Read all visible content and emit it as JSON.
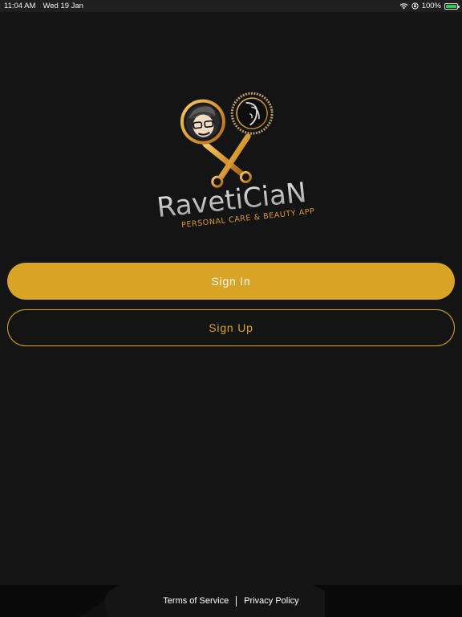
{
  "status_bar": {
    "time": "11:04 AM",
    "date": "Wed 19 Jan",
    "battery": "100%",
    "wifi_icon": "wifi-icon",
    "orientation_lock_icon": "orientation-lock-icon",
    "battery_icon": "battery-charging-icon"
  },
  "logo": {
    "name": "RavetiCiaN",
    "tagline": "PERSONAL CARE & BEAUTY APP"
  },
  "actions": {
    "sign_in": "Sign In",
    "sign_up": "Sign Up"
  },
  "footer": {
    "terms": "Terms of Service",
    "privacy": "Privacy Policy"
  },
  "colors": {
    "background": "#141414",
    "accent": "#d9a326",
    "footer": "#0a0a0a"
  }
}
